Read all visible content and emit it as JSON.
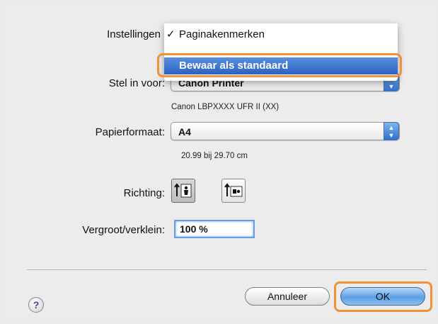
{
  "settings": {
    "label": "Instellingen",
    "menu_items": [
      {
        "label": "Paginakenmerken",
        "checked": true
      },
      {
        "label": "Bewaar als standaard",
        "checked": false
      }
    ]
  },
  "format_for": {
    "label": "Stel in voor:",
    "value": "Canon Printer",
    "detail": "Canon LBPXXXX UFR II (XX)"
  },
  "paper_size": {
    "label": "Papierformaat:",
    "value": "A4",
    "detail": "20.99 bij 29.70 cm"
  },
  "orientation": {
    "label": "Richting:",
    "options": [
      "portrait-icon",
      "landscape-icon"
    ],
    "selected": "portrait-icon"
  },
  "scale": {
    "label": "Vergroot/verklein:",
    "value": "100 %"
  },
  "buttons": {
    "help": "?",
    "cancel": "Annuleer",
    "ok": "OK"
  },
  "colors": {
    "highlight": "#f0923a",
    "selection": "#2a62c4"
  }
}
